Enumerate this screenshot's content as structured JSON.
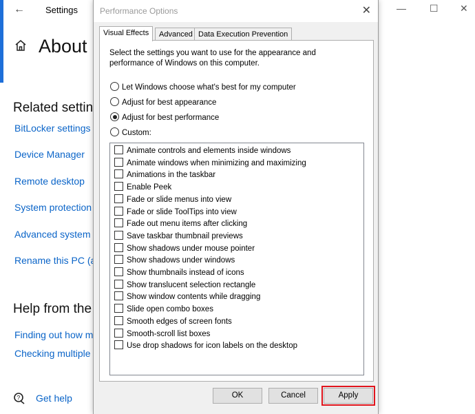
{
  "settings": {
    "app_title": "Settings",
    "page_title": "About",
    "related_heading": "Related settin",
    "related_links": [
      "BitLocker settings",
      "Device Manager",
      "Remote desktop",
      "System protection",
      "Advanced system s",
      "Rename this PC (ac"
    ],
    "help_heading": "Help from the",
    "help_links": [
      "Finding out how m",
      "Checking multiple"
    ],
    "get_help": "Get help",
    "accent_color": "#0a64c8"
  },
  "dialog": {
    "title": "Performance Options",
    "tabs": [
      "Visual Effects",
      "Advanced",
      "Data Execution Prevention"
    ],
    "active_tab": "Visual Effects",
    "description": "Select the settings you want to use for the appearance and performance of Windows on this computer.",
    "radios": [
      {
        "label": "Let Windows choose what's best for my computer",
        "selected": false
      },
      {
        "label": "Adjust for best appearance",
        "selected": false
      },
      {
        "label": "Adjust for best performance",
        "selected": true
      },
      {
        "label": "Custom:",
        "selected": false
      }
    ],
    "effects": [
      "Animate controls and elements inside windows",
      "Animate windows when minimizing and maximizing",
      "Animations in the taskbar",
      "Enable Peek",
      "Fade or slide menus into view",
      "Fade or slide ToolTips into view",
      "Fade out menu items after clicking",
      "Save taskbar thumbnail previews",
      "Show shadows under mouse pointer",
      "Show shadows under windows",
      "Show thumbnails instead of icons",
      "Show translucent selection rectangle",
      "Show window contents while dragging",
      "Slide open combo boxes",
      "Smooth edges of screen fonts",
      "Smooth-scroll list boxes",
      "Use drop shadows for icon labels on the desktop"
    ],
    "buttons": {
      "ok": "OK",
      "cancel": "Cancel",
      "apply": "Apply"
    },
    "highlight_color": "#e0141c"
  }
}
